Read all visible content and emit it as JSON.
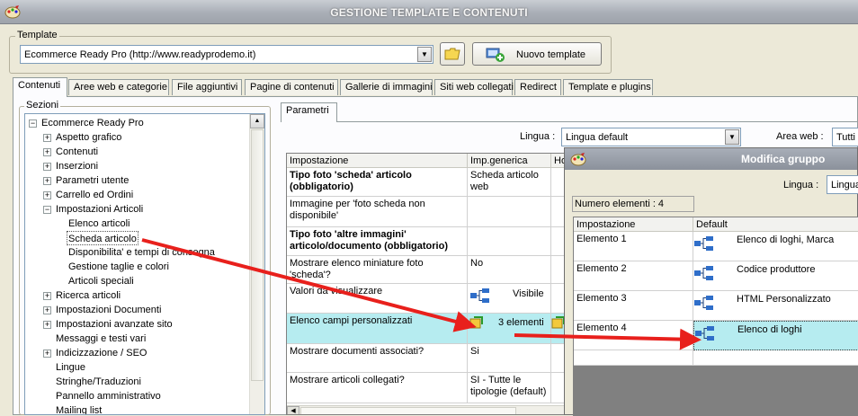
{
  "window": {
    "title": "GESTIONE TEMPLATE E CONTENUTI"
  },
  "template": {
    "group_label": "Template",
    "selected": "Ecommerce Ready Pro (http://www.readyprodemo.it)",
    "new_button": "Nuovo template"
  },
  "tabs": [
    "Contenuti",
    "Aree web e categorie",
    "File aggiuntivi",
    "Pagine di contenuti",
    "Gallerie di immagini",
    "Siti web collegati",
    "Redirect",
    "Template e plugins"
  ],
  "sections": {
    "label": "Sezioni",
    "root": "Ecommerce Ready Pro",
    "items": [
      "Aspetto grafico",
      "Contenuti",
      "Inserzioni",
      "Parametri utente",
      "Carrello ed Ordini",
      "Impostazioni Articoli",
      "Elenco articoli",
      "Scheda articolo",
      "Disponibilita' e tempi di consegna",
      "Gestione taglie e colori",
      "Articoli speciali",
      "Ricerca articoli",
      "Impostazioni Documenti",
      "Impostazioni avanzate sito",
      "Messaggi e testi vari",
      "Indicizzazione / SEO",
      "Lingue",
      "Stringhe/Traduzioni",
      "Pannello amministrativo",
      "Mailing list"
    ]
  },
  "params": {
    "tab_label": "Parametri",
    "lingua_label": "Lingua :",
    "lingua_value": "Lingua default",
    "area_label": "Area web :",
    "area_value": "Tutti",
    "headers": [
      "Impostazione",
      "Imp.generica",
      "Ho"
    ],
    "rows": [
      {
        "name": "Tipo foto 'scheda' articolo (obbligatorio)",
        "value": "Scheda articolo web"
      },
      {
        "name": "Immagine per 'foto scheda non disponibile'",
        "value": ""
      },
      {
        "name": "Tipo foto 'altre immagini' articolo/documento (obbligatorio)",
        "value": ""
      },
      {
        "name": "Mostrare elenco miniature foto 'scheda'?",
        "value": "No"
      },
      {
        "name": "Valori da visualizzare",
        "value": "Visibile"
      },
      {
        "name": "Elenco campi personalizzati",
        "value": "3 elementi"
      },
      {
        "name": "Mostrare documenti associati?",
        "value": "Si"
      },
      {
        "name": "Mostrare articoli collegati?",
        "value": "SI - Tutte le tipologie (default)"
      }
    ]
  },
  "dialog": {
    "title": "Modifica gruppo",
    "lingua_label": "Lingua :",
    "lingua_value": "Lingua",
    "count_label": "Numero elementi : 4",
    "headers": [
      "Impostazione",
      "Default"
    ],
    "rows": [
      {
        "name": "Elemento 1",
        "value": "Elenco di loghi, Marca"
      },
      {
        "name": "Elemento 2",
        "value": "Codice produttore"
      },
      {
        "name": "Elemento 3",
        "value": "HTML Personalizzato"
      },
      {
        "name": "Elemento 4",
        "value": "Elenco di loghi"
      }
    ]
  },
  "colors": {
    "selection": "#b6ecf0",
    "arrow": "#e8201c"
  }
}
